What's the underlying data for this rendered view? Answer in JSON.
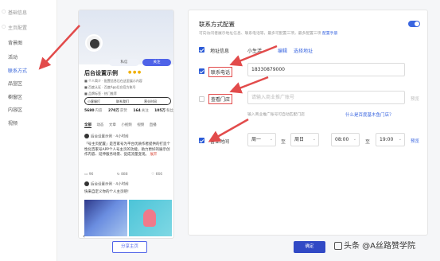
{
  "sidebar": {
    "items": [
      {
        "label": "基础信息",
        "state": "muted"
      },
      {
        "label": "主页配置",
        "state": "muted"
      },
      {
        "label": "背景图",
        "state": "normal"
      },
      {
        "label": "活动",
        "state": "normal"
      },
      {
        "label": "联系方式",
        "state": "active"
      },
      {
        "label": "品宣区",
        "state": "normal"
      },
      {
        "label": "橱窗区",
        "state": "normal"
      },
      {
        "label": "内容区",
        "state": "normal"
      },
      {
        "label": "视频",
        "state": "normal"
      }
    ]
  },
  "preview": {
    "btn_left": "私信",
    "btn_right": "关注",
    "name": "后台设置示例",
    "lines": [
      "■ 个人简介 · 配置信息后在这里展示内容",
      "■ 百度认证 · 百度App后台官方账号",
      "■ 品牌标签 · 热门推荐"
    ],
    "chips": [
      "小客服打",
      "联系我们",
      "营业时间"
    ],
    "stats": [
      {
        "value": "5680",
        "label": "内容"
      },
      {
        "value": "270万",
        "label": "获赞"
      },
      {
        "value": "164",
        "label": "关注"
      },
      {
        "value": "105万",
        "label": "粉丝"
      }
    ],
    "tabs": [
      "全部",
      "动态",
      "文章",
      "小视频",
      "视频",
      "直播"
    ],
    "post1_head": "后台设置示例 · 4小时前",
    "post1_text": "「号主页配置」是百家号为平台优质作者提供的打造个性化百家号APP个人号主页的功能，助力更好的展示创作内容、延伸服务场景、促成流量变现。",
    "post1_more": "展开",
    "actions": [
      "96",
      "888",
      "666"
    ],
    "post2_head": "后台设置示例 · 4小时前",
    "post2_text": "快来自定义你的个人主页吧!",
    "back": "‹"
  },
  "share_button": "分享主页",
  "form": {
    "title": "联系方式配置",
    "subtitle": "可向访问者展示地址信息、联系电话等，最多可配置三项，最多配置三项",
    "subtitle_link": "配置手册",
    "address": {
      "label": "地址信息",
      "value": "小生活",
      "edit": "编辑",
      "choose": "选择地址",
      "checked": true
    },
    "phone": {
      "label": "联系电话",
      "value": "18330879000",
      "checked": true
    },
    "store": {
      "label": "查看门店",
      "placeholder": "请输入商业推广账号",
      "preview": "预览",
      "hint": "输入商业推广账号可自动匹配门店",
      "hint_link": "什么是百度基木鱼门店？",
      "checked": false
    },
    "hours": {
      "label": "营业时间",
      "day_from": "周一",
      "day_to": "周日",
      "time_from": "08:00",
      "time_to": "19:00",
      "sep": "至",
      "preview": "预览",
      "checked": true
    }
  },
  "confirm_button": "确定",
  "watermark": "头条 @A丝路赞学院",
  "colors": {
    "accent": "#2b5bd7",
    "annotation": "#e24b4b"
  }
}
